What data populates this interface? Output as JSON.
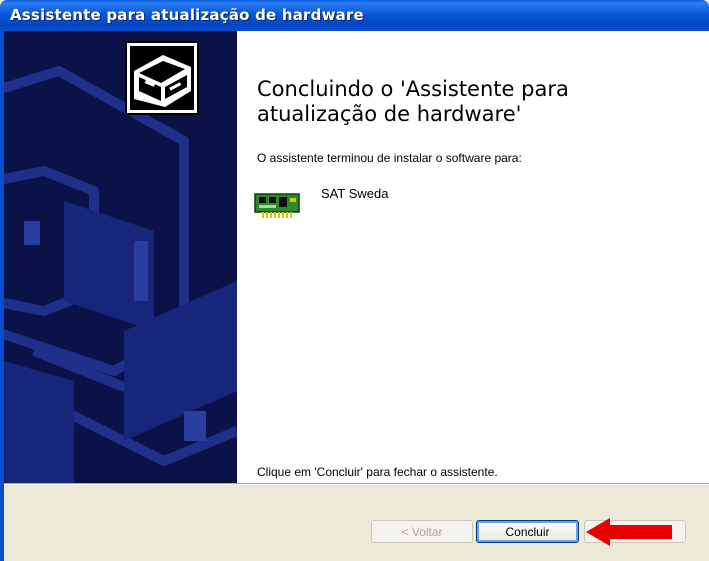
{
  "window": {
    "title": "Assistente para atualização de hardware"
  },
  "main": {
    "heading": "Concluindo o 'Assistente para atualização de hardware'",
    "subtext": "O assistente terminou de instalar o software para:",
    "device_name": "SAT Sweda",
    "closing_text": "Clique em 'Concluir' para fechar o assistente."
  },
  "buttons": {
    "back": "< Voltar",
    "finish": "Concluir",
    "cancel": "Cancelar"
  },
  "icons": {
    "wizard": "hardware-wizard-icon",
    "device": "circuit-board-icon",
    "annotation": "red-arrow-icon"
  },
  "colors": {
    "titlebar": "#0a57d8",
    "sidepanel": "#0b1247",
    "annotation_arrow": "#e60000"
  }
}
